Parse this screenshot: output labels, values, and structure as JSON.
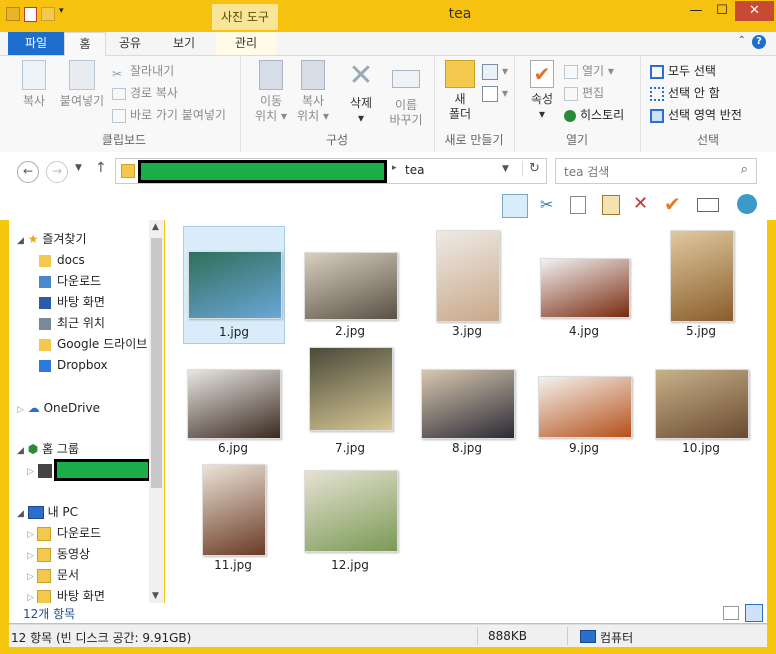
{
  "window": {
    "title": "tea",
    "context_tab_header": "사진 도구",
    "controls": {
      "minimize": "—",
      "maximize": "☐",
      "close": "✕"
    }
  },
  "ribbon_tabs": {
    "file": "파일",
    "home": "홈",
    "share": "공유",
    "view": "보기",
    "manage": "관리",
    "help": "?"
  },
  "ribbon": {
    "clipboard": {
      "label": "클립보드",
      "copy": "복사",
      "paste": "붙여넣기",
      "cut": "잘라내기",
      "copy_path": "경로 복사",
      "paste_shortcut": "바로 가기 붙여넣기"
    },
    "organize": {
      "label": "구성",
      "move_to": [
        "이동",
        "위치"
      ],
      "copy_to": [
        "복사",
        "위치"
      ],
      "delete": "삭제",
      "rename": [
        "이름",
        "바꾸기"
      ]
    },
    "new": {
      "label": "새로 만들기",
      "new_folder": [
        "새",
        "폴더"
      ]
    },
    "open": {
      "label": "열기",
      "properties": "속성",
      "open": "열기",
      "edit": "편집",
      "history": "히스토리"
    },
    "select": {
      "label": "선택",
      "select_all": "모두 선택",
      "select_none": "선택 안 함",
      "invert": "선택 영역 반전"
    }
  },
  "address": {
    "current_folder": "tea",
    "search_placeholder": "tea 검색"
  },
  "nav": {
    "favorites": "즐겨찾기",
    "fav_items": [
      "docs",
      "다운로드",
      "바탕 화면",
      "최근 위치",
      "Google 드라이브",
      "Dropbox"
    ],
    "onedrive": "OneDrive",
    "homegroup": "홈 그룹",
    "pc": "내 PC",
    "pc_items": [
      "다운로드",
      "동영상",
      "문서",
      "바탕 화면"
    ]
  },
  "files": [
    {
      "name": "1.jpg",
      "colors": [
        "#6aa6d8",
        "#2f6f5a"
      ]
    },
    {
      "name": "2.jpg",
      "colors": [
        "#5b5045",
        "#d8cfc0"
      ]
    },
    {
      "name": "3.jpg",
      "colors": [
        "#c9a88a",
        "#eeeae5"
      ]
    },
    {
      "name": "4.jpg",
      "colors": [
        "#7a2a10",
        "#f2f2f2"
      ]
    },
    {
      "name": "5.jpg",
      "colors": [
        "#8a5d2a",
        "#e0c9a0"
      ]
    },
    {
      "name": "6.jpg",
      "colors": [
        "#3a2a20",
        "#e8e6e2"
      ]
    },
    {
      "name": "7.jpg",
      "colors": [
        "#d7c795",
        "#4a4a3a"
      ]
    },
    {
      "name": "8.jpg",
      "colors": [
        "#2b2a35",
        "#d8c8b0"
      ]
    },
    {
      "name": "9.jpg",
      "colors": [
        "#b5501a",
        "#f4f2ef"
      ]
    },
    {
      "name": "10.jpg",
      "colors": [
        "#6a4a30",
        "#c7b28a"
      ]
    },
    {
      "name": "11.jpg",
      "colors": [
        "#6a3a25",
        "#ece4d8"
      ]
    },
    {
      "name": "12.jpg",
      "colors": [
        "#7a9a55",
        "#e6e2d2"
      ]
    }
  ],
  "status": {
    "item_count": "12개 항목",
    "details": "12 항목 (빈 디스크 공간: 9.91GB)",
    "size": "888KB",
    "location": "컴퓨터"
  }
}
